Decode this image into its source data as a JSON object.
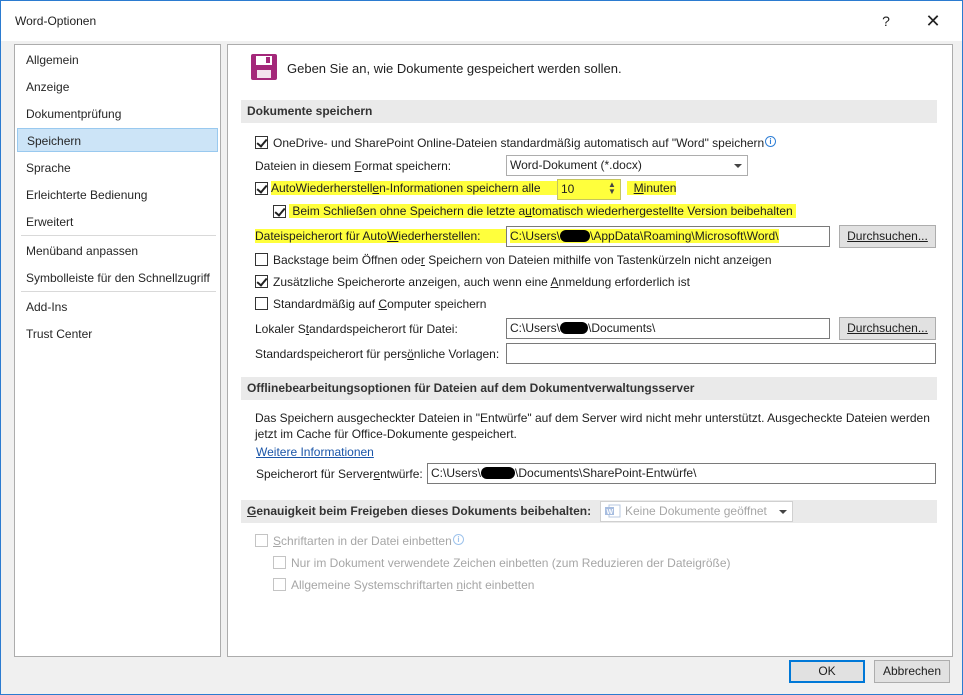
{
  "window": {
    "title": "Word-Optionen",
    "help_label": "?",
    "close_label": "✕"
  },
  "sidebar": {
    "items": [
      {
        "label": "Allgemein"
      },
      {
        "label": "Anzeige"
      },
      {
        "label": "Dokumentprüfung"
      },
      {
        "label": "Speichern",
        "active": true
      },
      {
        "label": "Sprache"
      },
      {
        "label": "Erleichterte Bedienung"
      },
      {
        "label": "Erweitert"
      },
      {
        "label": "Menüband anpassen"
      },
      {
        "label": "Symbolleiste für den Schnellzugriff"
      },
      {
        "label": "Add-Ins"
      },
      {
        "label": "Trust Center"
      }
    ]
  },
  "header": {
    "text": "Geben Sie an, wie Dokumente gespeichert werden sollen.",
    "icon": "floppy-disk-icon"
  },
  "save_section": {
    "title": "Dokumente speichern",
    "onedrive_default": {
      "label": "OneDrive- und SharePoint Online-Dateien standardmäßig automatisch auf \"Word\" speichern",
      "checked": true
    },
    "format_label_a": "Dateien in diesem ",
    "format_label_u": "F",
    "format_label_b": "ormat speichern:",
    "format_value": "Word-Dokument (*.docx)",
    "autorecover_label_a": "AutoWiederherstell",
    "autorecover_label_u": "e",
    "autorecover_label_b": "n-Informationen speichern alle",
    "autorecover_checked": true,
    "autorecover_minutes": "10",
    "minutes_label_a": "",
    "minutes_label_u": "M",
    "minutes_label_b": "inuten",
    "keep_last_label_a": "Beim Schließen ohne Speichern die letzte a",
    "keep_last_label_u": "u",
    "keep_last_label_b": "tomatisch wiederhergestellte Version beibehalten",
    "keep_last_checked": true,
    "autorecover_location_label_a": "Dateispeicherort für Auto",
    "autorecover_location_label_u": "W",
    "autorecover_location_label_b": "iederherstellen:",
    "autorecover_location_prefix": "C:\\Users\\",
    "autorecover_location_suffix": "\\AppData\\Roaming\\Microsoft\\Word\\",
    "browse_label": "Durchsuchen...",
    "backstage_label_a": "Backstage beim Öffnen ode",
    "backstage_label_u": "r",
    "backstage_label_b": " Speichern von Dateien mithilfe von Tastenkürzeln nicht anzeigen",
    "backstage_checked": false,
    "additional_locations_label_a": "Zusätzliche Speicherorte anzeigen, auch wenn eine ",
    "additional_locations_label_u": "A",
    "additional_locations_label_b": "nmeldung erforderlich ist",
    "additional_locations_checked": true,
    "save_to_computer_label_a": "Standardmäßig auf ",
    "save_to_computer_label_u": "C",
    "save_to_computer_label_b": "omputer speichern",
    "save_to_computer_checked": false,
    "local_default_label_a": "Lokaler S",
    "local_default_label_u": "t",
    "local_default_label_b": "andardspeicherort für Datei:",
    "local_default_prefix": "C:\\Users\\",
    "local_default_suffix": "\\Documents\\",
    "templates_label_a": "Standardspeicherort für pers",
    "templates_label_u": "ö",
    "templates_label_b": "nliche Vorlagen:",
    "templates_value": ""
  },
  "offline_section": {
    "title": "Offlinebearbeitungsoptionen für Dateien auf dem Dokumentverwaltungsserver",
    "desc_line1": "Das Speichern ausgecheckter Dateien in \"Entwürfe\" auf dem Server wird nicht mehr unterstützt. Ausgecheckte Dateien werden",
    "desc_line2": "jetzt im Cache für Office-Dokumente gespeichert.",
    "more_info": "Weitere Informationen",
    "drafts_label_a": "Speicherort für Server",
    "drafts_label_u": "e",
    "drafts_label_b": "ntwürfe:",
    "drafts_prefix": "C:\\Users\\",
    "drafts_suffix": "\\Documents\\SharePoint-Entwürfe\\"
  },
  "fidelity_section": {
    "title_a": "",
    "title_u": "G",
    "title_b": "enauigkeit beim Freigeben dieses Dokuments beibehalten:",
    "doc_select": "Keine Dokumente geöffnet",
    "embed_fonts_a": "",
    "embed_fonts_u": "S",
    "embed_fonts_b": "chriftarten in der Datei einbetten",
    "only_used_chars": "Nur im Dokument verwendete Zeichen einbetten (zum Reduzieren der Dateigröße)",
    "no_system_fonts_a": "Allgemeine Systemschriftarten ",
    "no_system_fonts_u": "n",
    "no_system_fonts_b": "icht einbetten"
  },
  "footer": {
    "ok_label": "OK",
    "cancel_label": "Abbrechen"
  }
}
